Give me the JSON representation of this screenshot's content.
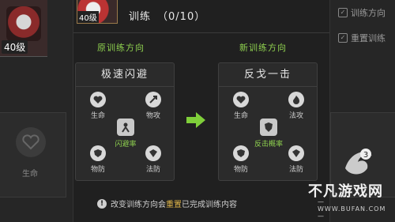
{
  "background": {
    "card_level": "40级",
    "tile_label": "生命",
    "right_buttons": [
      "训练方向",
      "重置训练"
    ]
  },
  "header": {
    "avatar_level": "40级",
    "title": "训练",
    "count": "（0/10）"
  },
  "direction_labels": {
    "old": "原训练方向",
    "new": "新训练方向"
  },
  "old_card": {
    "title": "极速闪避",
    "stats": {
      "top_left": "生命",
      "top_right": "物攻",
      "center": "闪避率",
      "bottom_left": "物防",
      "bottom_right": "法防"
    }
  },
  "new_card": {
    "title": "反戈一击",
    "stats": {
      "top_left": "生命",
      "top_right": "法攻",
      "center": "反击概率",
      "bottom_left": "物防",
      "bottom_right": "法防"
    }
  },
  "notice": {
    "before": "改变训练方向会",
    "highlight": "重置",
    "after": "已完成训练内容"
  },
  "watermark": {
    "name": "不凡游戏网",
    "url": "— WWW.BUFAN.COM —"
  },
  "colors": {
    "accent_green": "#8fd14f",
    "warning_gold": "#e0b64a"
  }
}
